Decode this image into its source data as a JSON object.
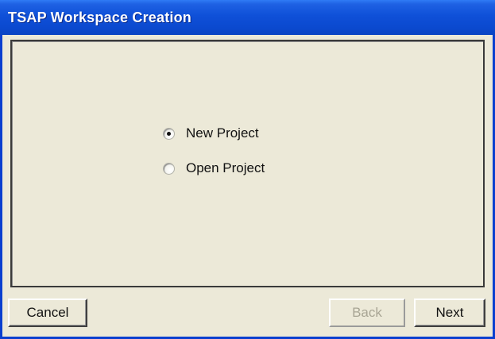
{
  "window": {
    "title": "TSAP Workspace Creation"
  },
  "options": [
    {
      "label": "New Project",
      "selected": true
    },
    {
      "label": "Open Project",
      "selected": false
    }
  ],
  "buttons": {
    "cancel": "Cancel",
    "back": "Back",
    "next": "Next"
  },
  "colors": {
    "titlebar": "#0b49cf",
    "face": "#ece9d8",
    "disabled_text": "#a8a594"
  }
}
